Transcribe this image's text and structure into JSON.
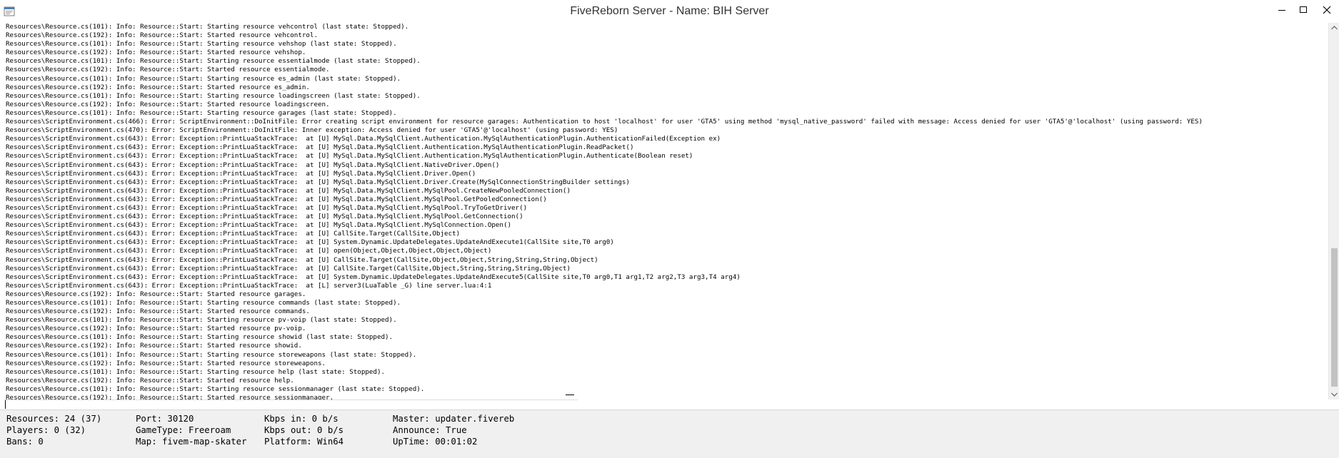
{
  "window": {
    "title": "FiveReborn Server - Name: BIH Server",
    "app_icon": "app-icon",
    "controls": {
      "minimize_icon": "minimize-icon",
      "maximize_icon": "maximize-icon",
      "close_icon": "close-icon"
    }
  },
  "console": {
    "lines": [
      "Resources\\Resource.cs(101): Info: Resource::Start: Starting resource vehcontrol (last state: Stopped).",
      "Resources\\Resource.cs(192): Info: Resource::Start: Started resource vehcontrol.",
      "Resources\\Resource.cs(101): Info: Resource::Start: Starting resource vehshop (last state: Stopped).",
      "Resources\\Resource.cs(192): Info: Resource::Start: Started resource vehshop.",
      "Resources\\Resource.cs(101): Info: Resource::Start: Starting resource essentialmode (last state: Stopped).",
      "Resources\\Resource.cs(192): Info: Resource::Start: Started resource essentialmode.",
      "Resources\\Resource.cs(101): Info: Resource::Start: Starting resource es_admin (last state: Stopped).",
      "Resources\\Resource.cs(192): Info: Resource::Start: Started resource es_admin.",
      "Resources\\Resource.cs(101): Info: Resource::Start: Starting resource loadingscreen (last state: Stopped).",
      "Resources\\Resource.cs(192): Info: Resource::Start: Started resource loadingscreen.",
      "Resources\\Resource.cs(101): Info: Resource::Start: Starting resource garages (last state: Stopped).",
      "Resources\\ScriptEnvironment.cs(466): Error: ScriptEnvironment::DoInitFile: Error creating script environment for resource garages: Authentication to host 'localhost' for user 'GTA5' using method 'mysql_native_password' failed with message: Access denied for user 'GTA5'@'localhost' (using password: YES)",
      "Resources\\ScriptEnvironment.cs(470): Error: ScriptEnvironment::DoInitFile: Inner exception: Access denied for user 'GTA5'@'localhost' (using password: YES)",
      "Resources\\ScriptEnvironment.cs(643): Error: Exception::PrintLuaStackTrace:  at [U] MySql.Data.MySqlClient.Authentication.MySqlAuthenticationPlugin.AuthenticationFailed(Exception ex)",
      "Resources\\ScriptEnvironment.cs(643): Error: Exception::PrintLuaStackTrace:  at [U] MySql.Data.MySqlClient.Authentication.MySqlAuthenticationPlugin.ReadPacket()",
      "Resources\\ScriptEnvironment.cs(643): Error: Exception::PrintLuaStackTrace:  at [U] MySql.Data.MySqlClient.Authentication.MySqlAuthenticationPlugin.Authenticate(Boolean reset)",
      "Resources\\ScriptEnvironment.cs(643): Error: Exception::PrintLuaStackTrace:  at [U] MySql.Data.MySqlClient.NativeDriver.Open()",
      "Resources\\ScriptEnvironment.cs(643): Error: Exception::PrintLuaStackTrace:  at [U] MySql.Data.MySqlClient.Driver.Open()",
      "Resources\\ScriptEnvironment.cs(643): Error: Exception::PrintLuaStackTrace:  at [U] MySql.Data.MySqlClient.Driver.Create(MySqlConnectionStringBuilder settings)",
      "Resources\\ScriptEnvironment.cs(643): Error: Exception::PrintLuaStackTrace:  at [U] MySql.Data.MySqlClient.MySqlPool.CreateNewPooledConnection()",
      "Resources\\ScriptEnvironment.cs(643): Error: Exception::PrintLuaStackTrace:  at [U] MySql.Data.MySqlClient.MySqlPool.GetPooledConnection()",
      "Resources\\ScriptEnvironment.cs(643): Error: Exception::PrintLuaStackTrace:  at [U] MySql.Data.MySqlClient.MySqlPool.TryToGetDriver()",
      "Resources\\ScriptEnvironment.cs(643): Error: Exception::PrintLuaStackTrace:  at [U] MySql.Data.MySqlClient.MySqlPool.GetConnection()",
      "Resources\\ScriptEnvironment.cs(643): Error: Exception::PrintLuaStackTrace:  at [U] MySql.Data.MySqlClient.MySqlConnection.Open()",
      "Resources\\ScriptEnvironment.cs(643): Error: Exception::PrintLuaStackTrace:  at [U] CallSite.Target(CallSite,Object)",
      "Resources\\ScriptEnvironment.cs(643): Error: Exception::PrintLuaStackTrace:  at [U] System.Dynamic.UpdateDelegates.UpdateAndExecute1(CallSite site,T0 arg0)",
      "Resources\\ScriptEnvironment.cs(643): Error: Exception::PrintLuaStackTrace:  at [U] open(Object,Object,Object,Object,Object)",
      "Resources\\ScriptEnvironment.cs(643): Error: Exception::PrintLuaStackTrace:  at [U] CallSite.Target(CallSite,Object,Object,String,String,String,Object)",
      "Resources\\ScriptEnvironment.cs(643): Error: Exception::PrintLuaStackTrace:  at [U] CallSite.Target(CallSite,Object,String,String,String,Object)",
      "Resources\\ScriptEnvironment.cs(643): Error: Exception::PrintLuaStackTrace:  at [U] System.Dynamic.UpdateDelegates.UpdateAndExecute5(CallSite site,T0 arg0,T1 arg1,T2 arg2,T3 arg3,T4 arg4)",
      "Resources\\ScriptEnvironment.cs(643): Error: Exception::PrintLuaStackTrace:  at [L] server3(LuaTable _G) line server.lua:4:1",
      "Resources\\Resource.cs(192): Info: Resource::Start: Started resource garages.",
      "Resources\\Resource.cs(101): Info: Resource::Start: Starting resource commands (last state: Stopped).",
      "Resources\\Resource.cs(192): Info: Resource::Start: Started resource commands.",
      "Resources\\Resource.cs(101): Info: Resource::Start: Starting resource pv-voip (last state: Stopped).",
      "Resources\\Resource.cs(192): Info: Resource::Start: Started resource pv-voip.",
      "Resources\\Resource.cs(101): Info: Resource::Start: Starting resource showid (last state: Stopped).",
      "Resources\\Resource.cs(192): Info: Resource::Start: Started resource showid.",
      "Resources\\Resource.cs(101): Info: Resource::Start: Starting resource storeweapons (last state: Stopped).",
      "Resources\\Resource.cs(192): Info: Resource::Start: Started resource storeweapons.",
      "Resources\\Resource.cs(101): Info: Resource::Start: Starting resource help (last state: Stopped).",
      "Resources\\Resource.cs(192): Info: Resource::Start: Started resource help.",
      "Resources\\Resource.cs(101): Info: Resource::Start: Starting resource sessionmanager (last state: Stopped).",
      "Resources\\Resource.cs(192): Info: Resource::Start: Started resource sessionmanager."
    ],
    "scroll_up_icon": "scroll-up-icon",
    "scroll_down_icon": "scroll-down-icon"
  },
  "command_input": {
    "value": ""
  },
  "status": {
    "resources": "Resources: 24 (37)",
    "players": "Players: 0 (32)",
    "bans": "Bans: 0",
    "port": "Port: 30120",
    "gametype": "GameType: Freeroam",
    "map": "Map: fivem-map-skater",
    "kbps_in": "Kbps in: 0 b/s",
    "kbps_out": "Kbps out: 0 b/s",
    "platform": "Platform: Win64",
    "master": "Master: updater.fivereb",
    "announce": "Announce: True",
    "uptime": "UpTime: 00:01:02"
  }
}
